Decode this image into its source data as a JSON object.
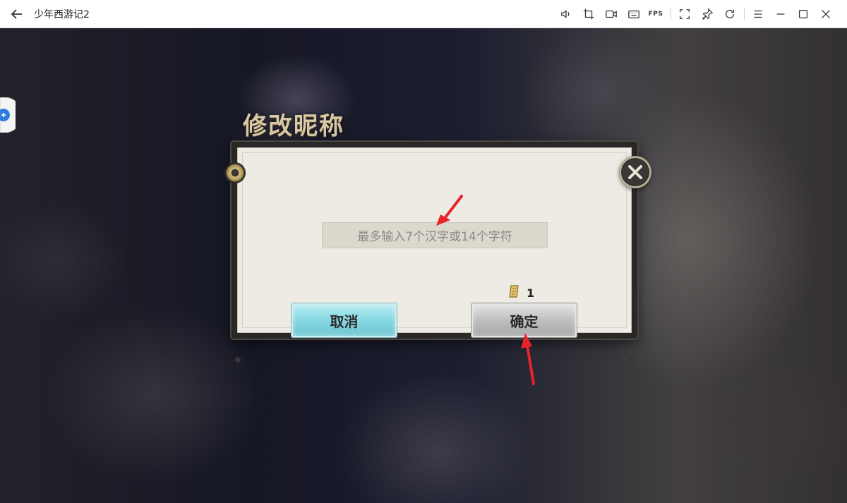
{
  "titlebar": {
    "title": "少年西游记2",
    "fps_label": "FPS",
    "icons": [
      "back-arrow-icon",
      "volume-icon",
      "crop-icon",
      "video-record-icon",
      "keyboard-icon",
      "fps-icon",
      "fullscreen-icon",
      "pin-icon",
      "rotate-icon",
      "menu-icon",
      "minimize-icon",
      "maximize-icon",
      "close-icon"
    ]
  },
  "dialog": {
    "title": "修改昵称",
    "input_placeholder": "最多输入7个汉字或14个字符",
    "cost_value": "1",
    "cancel_label": "取消",
    "confirm_label": "确定"
  },
  "colors": {
    "arrow": "#e8232a",
    "cancel_button": "#86d7e1",
    "confirm_button": "#bfbfbf",
    "title_gold": "#d8c8a4"
  }
}
